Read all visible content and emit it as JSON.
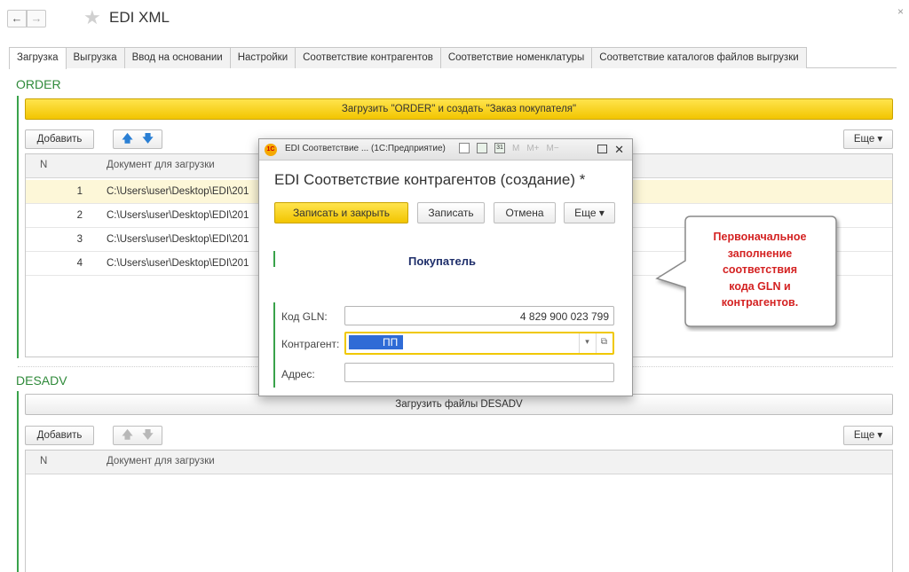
{
  "header": {
    "back_glyph": "←",
    "forward_glyph": "→",
    "star_glyph": "★",
    "title": "EDI XML",
    "close_glyph": "×"
  },
  "tabs": [
    {
      "label": "Загрузка",
      "active": true
    },
    {
      "label": "Выгрузка"
    },
    {
      "label": "Ввод на основании"
    },
    {
      "label": "Настройки"
    },
    {
      "label": "Соответствие контрагентов"
    },
    {
      "label": "Соответствие номенклатуры"
    },
    {
      "label": "Соответствие каталогов файлов выгрузки"
    }
  ],
  "order": {
    "label": "ORDER",
    "load_button": "Загрузить \"ORDER\" и создать \"Заказ покупателя\"",
    "add_button": "Добавить",
    "more_button": "Еще ▾",
    "up_glyph": "🡅",
    "down_glyph": "🡇",
    "columns": [
      "N",
      "Документ для загрузки"
    ],
    "rows": [
      {
        "n": "1",
        "doc": "C:\\Users\\user\\Desktop\\EDI\\201",
        "selected": true
      },
      {
        "n": "2",
        "doc": "C:\\Users\\user\\Desktop\\EDI\\201"
      },
      {
        "n": "3",
        "doc": "C:\\Users\\user\\Desktop\\EDI\\201"
      },
      {
        "n": "4",
        "doc": "C:\\Users\\user\\Desktop\\EDI\\201"
      }
    ]
  },
  "desadv": {
    "label": "DESADV",
    "load_button": "Загрузить файлы DESADV",
    "add_button": "Добавить",
    "more_button": "Еще ▾",
    "up_glyph": "🡅",
    "down_glyph": "🡇",
    "columns": [
      "N",
      "Документ для загрузки"
    ]
  },
  "modal": {
    "logo": "1С",
    "window_title": "EDI Соответствие ... (1С:Предприятие)",
    "title_buttons": {
      "m": "M",
      "mplus": "M+",
      "mminus": "M−",
      "calendar": "31",
      "close": "✕"
    },
    "heading": "EDI Соответствие контрагентов (создание) *",
    "save_close_button": "Записать и закрыть",
    "save_button": "Записать",
    "cancel_button": "Отмена",
    "more_button": "Еще ▾",
    "group_title": "Покупатель",
    "fields": {
      "gln_label": "Код GLN:",
      "gln_value": "4 829 900 023 799",
      "contractor_label": "Контрагент:",
      "contractor_value": "ПП",
      "address_label": "Адрес:",
      "address_value": ""
    },
    "dropdown_glyph": "▾",
    "open_glyph": "⧉"
  },
  "callout": {
    "lines": [
      "Первоначальное",
      "заполнение",
      "соответствия",
      "кода GLN и",
      "контрагентов."
    ],
    "color": "#d42222"
  },
  "colors": {
    "accent_green": "#39a24a",
    "button_yellow": "#f2c500",
    "selected_row": "#fdf7d8",
    "selection_blue": "#2f6bd6"
  }
}
